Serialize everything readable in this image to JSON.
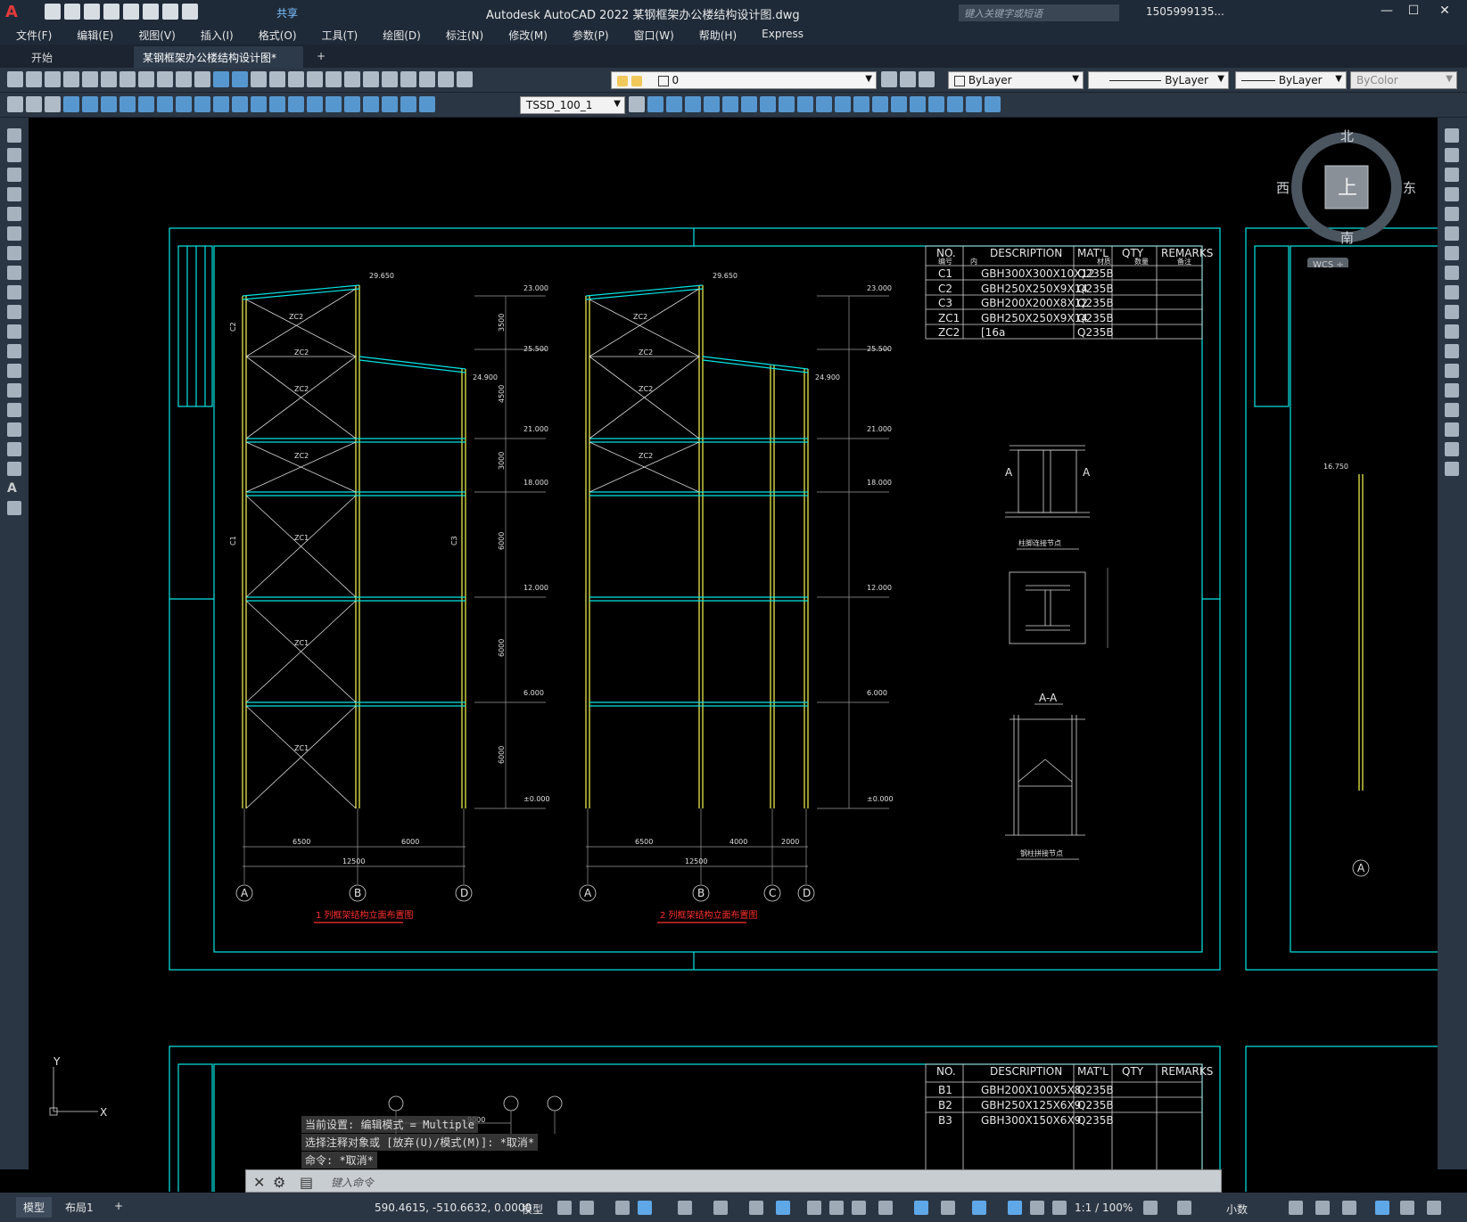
{
  "app": {
    "logo": "A",
    "title": "Autodesk AutoCAD 2022    某钢框架办公楼结构设计图.dwg",
    "share": "共享",
    "search_placeholder": "键入关键字或短语",
    "user": "1505999135...",
    "help": "?"
  },
  "menu": [
    "文件(F)",
    "编辑(E)",
    "视图(V)",
    "插入(I)",
    "格式(O)",
    "工具(T)",
    "绘图(D)",
    "标注(N)",
    "修改(M)",
    "参数(P)",
    "窗口(W)",
    "帮助(H)",
    "Express"
  ],
  "tabs": {
    "start": "开始",
    "doc": "某钢框架办公楼结构设计图*",
    "add": "+"
  },
  "props": {
    "layer": "0",
    "color": "ByLayer",
    "linetype": "ByLayer",
    "lineweight": "ByLayer",
    "plotstyle": "ByColor",
    "dimstyle": "TSSD_100_1"
  },
  "compass": {
    "n": "北",
    "s": "南",
    "e": "东",
    "w": "西",
    "center": "上",
    "wcs": "WCS ÷"
  },
  "table": {
    "headers": [
      "NO.",
      "DESCRIPTION",
      "MAT'L",
      "QTY",
      "REMARKS"
    ],
    "sub": [
      "编号",
      "内",
      "材质",
      "数量",
      "备注"
    ],
    "rows": [
      [
        "C1",
        "GBH300X300X10X12",
        "Q235B"
      ],
      [
        "C2",
        "GBH250X250X9X14",
        "Q235B"
      ],
      [
        "C3",
        "GBH200X200X8X12",
        "Q235B"
      ],
      [
        "ZC1",
        "GBH250X250X9X14",
        "Q235B"
      ],
      [
        "ZC2",
        "[16a",
        "Q235B"
      ]
    ]
  },
  "table2": {
    "rows": [
      [
        "B1",
        "GBH200X100X5X8",
        "Q235B"
      ],
      [
        "B2",
        "GBH250X125X6X9",
        "Q235B"
      ],
      [
        "B3",
        "GBH300X150X6X9",
        "Q235B"
      ]
    ]
  },
  "drawing": {
    "levels": [
      "29.650",
      "23.000",
      "25.500",
      "24.900",
      "21.000",
      "18.000",
      "12.000",
      "6.000",
      "±0.000"
    ],
    "dims1": [
      "6500",
      "6000",
      "12500"
    ],
    "dims2": [
      "6500",
      "4000",
      "2000",
      "12500"
    ],
    "vdims": [
      "3500",
      "4500",
      "3000",
      "6000",
      "6000",
      "6000"
    ],
    "axes1": [
      "A",
      "B",
      "D"
    ],
    "axes2": [
      "A",
      "B",
      "C",
      "D"
    ],
    "brace": [
      "ZC2",
      "ZC2",
      "ZC2",
      "ZC2",
      "ZC1",
      "ZC1",
      "ZC1"
    ],
    "col_labels": [
      "C2",
      "C1",
      "C3"
    ],
    "title1": "1 列框架结构立面布置图",
    "title2": "2 列框架结构立面布置图",
    "detail1": "柱脚连接节点",
    "detail2": "A-A",
    "detail3": "钢柱拼接节点",
    "detail_label_a": "A",
    "right_level": "16.750",
    "ucs_x": "X",
    "ucs_y": "Y",
    "bottom_dim": "9000"
  },
  "cmd": {
    "h1": "当前设置: 编辑模式 = Multiple",
    "h2": "选择注释对象或 [放弃(U)/模式(M)]: *取消*",
    "h3": "命令: *取消*",
    "placeholder": "键入命令"
  },
  "status": {
    "model_tab": "模型",
    "layout_tab": "布局1",
    "coords": "590.4615, -510.6632, 0.0000",
    "model": "模型",
    "scale": "1:1 / 100%",
    "units": "小数"
  },
  "colors": {
    "cyan": "#00e5e5",
    "yellow": "#e8e84a",
    "white": "#e0e0e0",
    "red": "#ff3030",
    "bg": "#000000",
    "ui": "#2b3644"
  }
}
